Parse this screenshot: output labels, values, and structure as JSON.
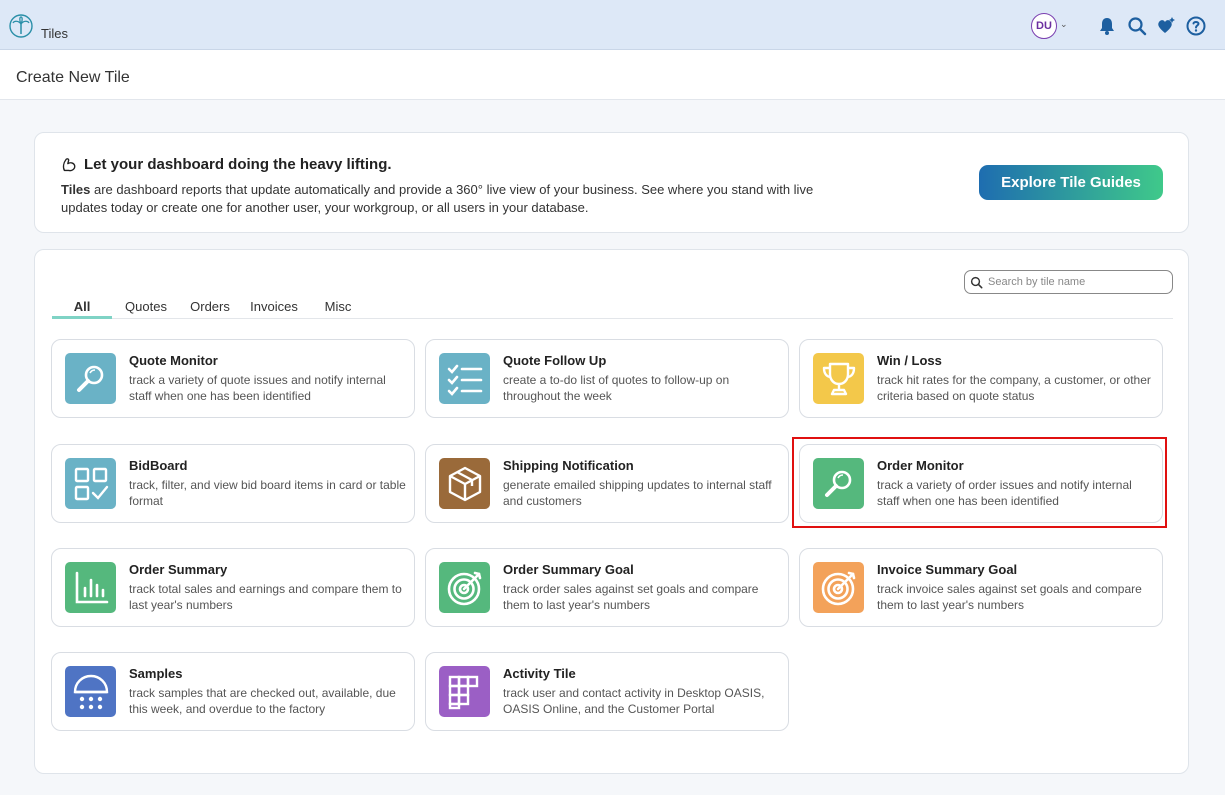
{
  "topbar": {
    "app_name": "Tiles",
    "user_initials": "DU"
  },
  "page": {
    "title": "Create New Tile"
  },
  "intro": {
    "heading": "Let your dashboard doing the heavy lifting.",
    "bold_word": "Tiles",
    "text": " are dashboard reports that update automatically and provide a 360° live view of your business. See where you stand with live updates today or create one for another user, your workgroup, or all users in your database.",
    "button_label": "Explore Tile Guides"
  },
  "search": {
    "placeholder": "Search by tile name"
  },
  "tabs": [
    {
      "label": "All",
      "active": true
    },
    {
      "label": "Quotes"
    },
    {
      "label": "Orders"
    },
    {
      "label": "Invoices"
    },
    {
      "label": "Misc"
    }
  ],
  "tiles": [
    {
      "title": "Quote Monitor",
      "desc": "track a variety of quote issues and notify internal staff when one has been identified",
      "icon": "magnifier-icon",
      "color": "#6ab2c6"
    },
    {
      "title": "Quote Follow Up",
      "desc": "create a to-do list of quotes to follow-up on throughout the week",
      "icon": "checklist-icon",
      "color": "#6ab2c6"
    },
    {
      "title": "Win / Loss",
      "desc": "track hit rates for the company, a customer, or other criteria based on quote status",
      "icon": "trophy-icon",
      "color": "#f3c84a"
    },
    {
      "title": "BidBoard",
      "desc": "track, filter, and view bid board items in card or table format",
      "icon": "bidboard-icon",
      "color": "#6ab2c6"
    },
    {
      "title": "Shipping Notification",
      "desc": "generate emailed shipping updates to internal staff and customers",
      "icon": "package-icon",
      "color": "#9a6a3a"
    },
    {
      "title": "Order Monitor",
      "desc": "track a variety of order issues and notify internal staff when one has been identified",
      "icon": "magnifier-icon",
      "color": "#55b87d"
    },
    {
      "title": "Order Summary",
      "desc": "track total sales and earnings and compare them to last year's numbers",
      "icon": "bar-chart-icon",
      "color": "#55b87d"
    },
    {
      "title": "Order Summary Goal",
      "desc": "track order sales against set goals and compare them to last year's numbers",
      "icon": "target-icon",
      "color": "#55b87d"
    },
    {
      "title": "Invoice Summary Goal",
      "desc": "track invoice sales against set goals and compare them to last year's numbers",
      "icon": "target-icon",
      "color": "#f3a25a"
    },
    {
      "title": "Samples",
      "desc": "track samples that are checked out, available, due this week, and overdue to the factory",
      "icon": "samples-icon",
      "color": "#4f74c4"
    },
    {
      "title": "Activity Tile",
      "desc": "track user and contact activity in Desktop OASIS, OASIS Online, and the Customer Portal",
      "icon": "activity-grid-icon",
      "color": "#9b5fc5"
    }
  ]
}
